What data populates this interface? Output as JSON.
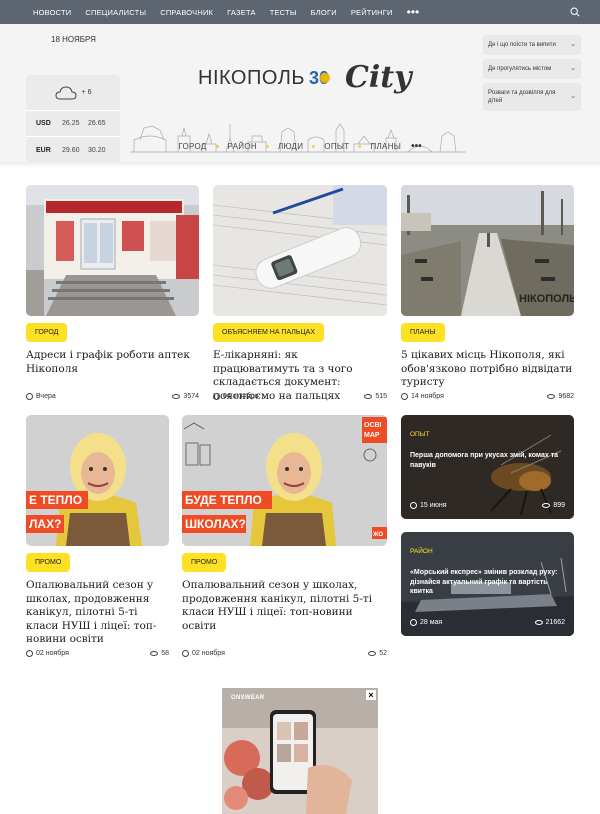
{
  "topnav": {
    "items": [
      "НОВОСТИ",
      "СПЕЦИАЛИСТЫ",
      "СПРАВОЧНИК",
      "ГАЗЕТА",
      "ТЕСТЫ",
      "БЛОГИ",
      "РЕЙТИНГИ"
    ],
    "more": "•••"
  },
  "header": {
    "date": "18 НОЯБРЯ",
    "weather": {
      "temp": "+ 6",
      "icon": "cloud-icon"
    },
    "rates": [
      {
        "cur": "USD",
        "buy": "26.25",
        "sell": "26.65"
      },
      {
        "cur": "EUR",
        "buy": "29.60",
        "sell": "30.20"
      }
    ],
    "logo": {
      "name": "НІКОПОЛЬ",
      "number": "30",
      "city": "City"
    },
    "dropdowns": [
      "Де і що поїсти та випити",
      "Де прогулятись містом",
      "Розваги та дозвілля для дітей"
    ],
    "menu": [
      "ГОРОД",
      "РАЙОН",
      "ЛЮДИ",
      "ОПЫТ",
      "ПЛАНЫ"
    ],
    "menu_more": "•••"
  },
  "articles": [
    {
      "badge": "ГОРОД",
      "title": "Адреси і графік роботи аптек Нікополя",
      "date": "Вчера",
      "views": "3574"
    },
    {
      "badge": "ОБЪЯСНЯЕМ НА ПАЛЬЦАХ",
      "title": "Е-лікарняні: як працюватимуть та з чого складається документ: пояснюємо на пальцях",
      "date": "04 октября",
      "views": "515"
    },
    {
      "badge": "ПЛАНЫ",
      "title": "5 цікавих місць Нікополя, які обов'язково потрібно відвідати туристу",
      "date": "14 ноября",
      "views": "9682",
      "watermark": "НІКОПОЛЬ"
    },
    {
      "badge": "ПРОМО",
      "title": "Опалювальний сезон у школах, продовження канікул, пілотні 5-ті класи НУШ і ліцеї: топ-новини освіти",
      "date": "02 ноября",
      "views": "58",
      "banner": [
        "Е ТЕПЛО",
        "ЛАХ?"
      ]
    },
    {
      "badge": "ПРОМО",
      "title": "Опалювальний сезон у школах, продовження канікул, пілотні 5-ті класи НУШ і ліцеї: топ-новини освіти",
      "date": "02 ноября",
      "views": "52",
      "banner": [
        "БУДЕ ТЕПЛО",
        "ШКОЛАХ?"
      ],
      "side": [
        "ОСВІ",
        "МАР"
      ],
      "corner": "ЖО"
    }
  ],
  "side_articles": [
    {
      "cat": "ОПЫТ",
      "title": "Перша допомога при укусах змій, комах та павуків",
      "date": "15 июня",
      "views": "899"
    },
    {
      "cat": "РАЙОН",
      "title": "«Морський експрес» змінив розклад руху: дізнайся актуальний графік та вартість квитка",
      "date": "28 мая",
      "views": "21662"
    }
  ],
  "ad": {
    "brand": "ONSWEAR",
    "close": "×"
  },
  "colors": {
    "accent": "#ffe124",
    "nav": "#5d6570"
  }
}
